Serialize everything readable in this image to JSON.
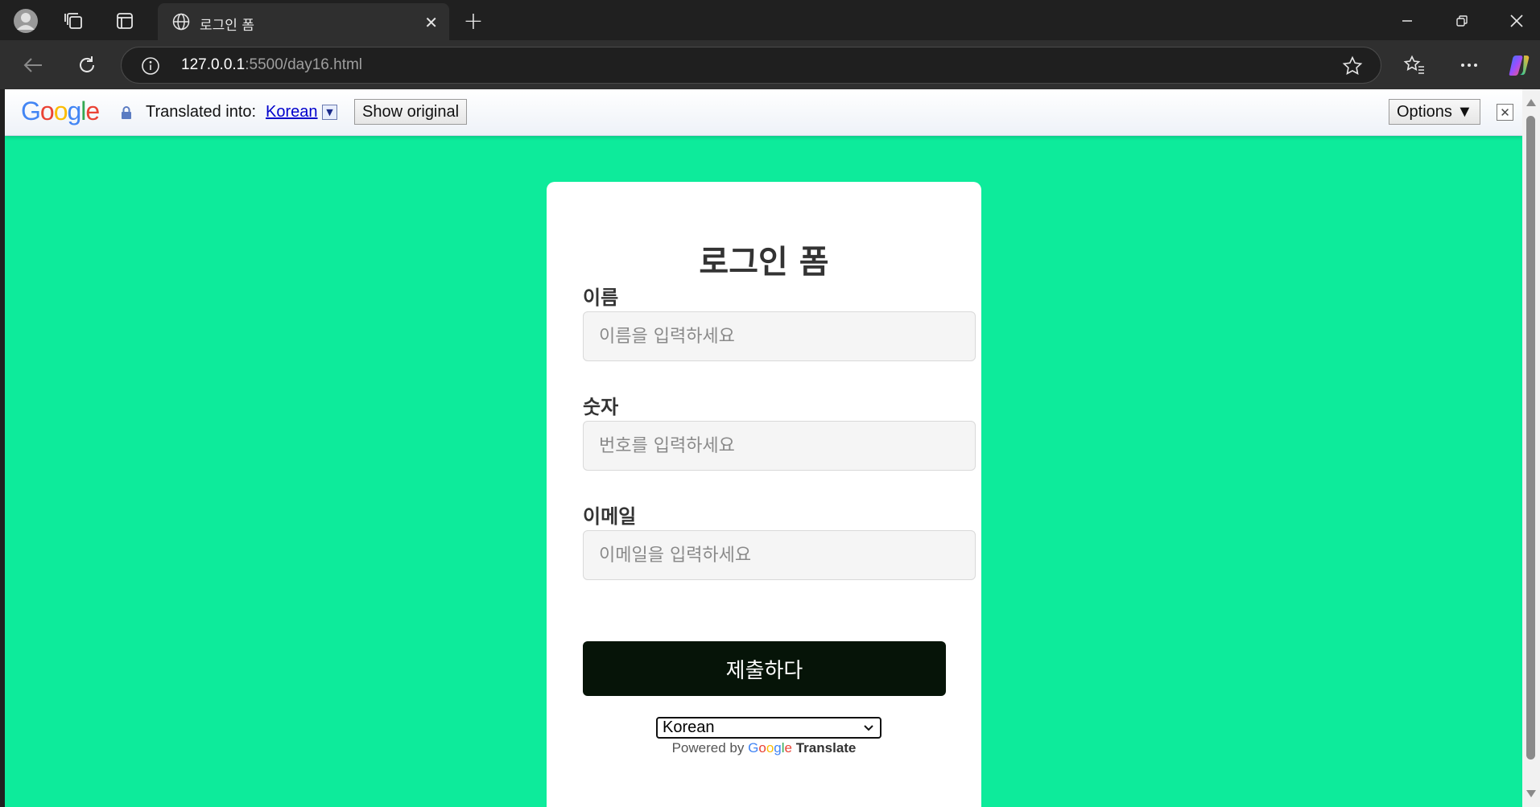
{
  "browser": {
    "tab_title": "로그인 폼",
    "url_host": "127.0.0.1",
    "url_rest": ":5500/day16.html"
  },
  "translate_bar": {
    "logo": "Google",
    "translated_into": "Translated into:",
    "language": "Korean",
    "show_original": "Show original",
    "options": "Options ▼"
  },
  "form": {
    "title": "로그인 폼",
    "fields": [
      {
        "label": "이름",
        "placeholder": "이름을 입력하세요"
      },
      {
        "label": "숫자",
        "placeholder": "번호를 입력하세요"
      },
      {
        "label": "이메일",
        "placeholder": "이메일을 입력하세요"
      }
    ],
    "submit": "제출하다",
    "language_select": "Korean",
    "powered_by": "Powered by",
    "powered_google": "Google",
    "powered_translate": "Translate"
  },
  "colors": {
    "page_background": "#0deb9b",
    "submit_background": "#061408"
  }
}
